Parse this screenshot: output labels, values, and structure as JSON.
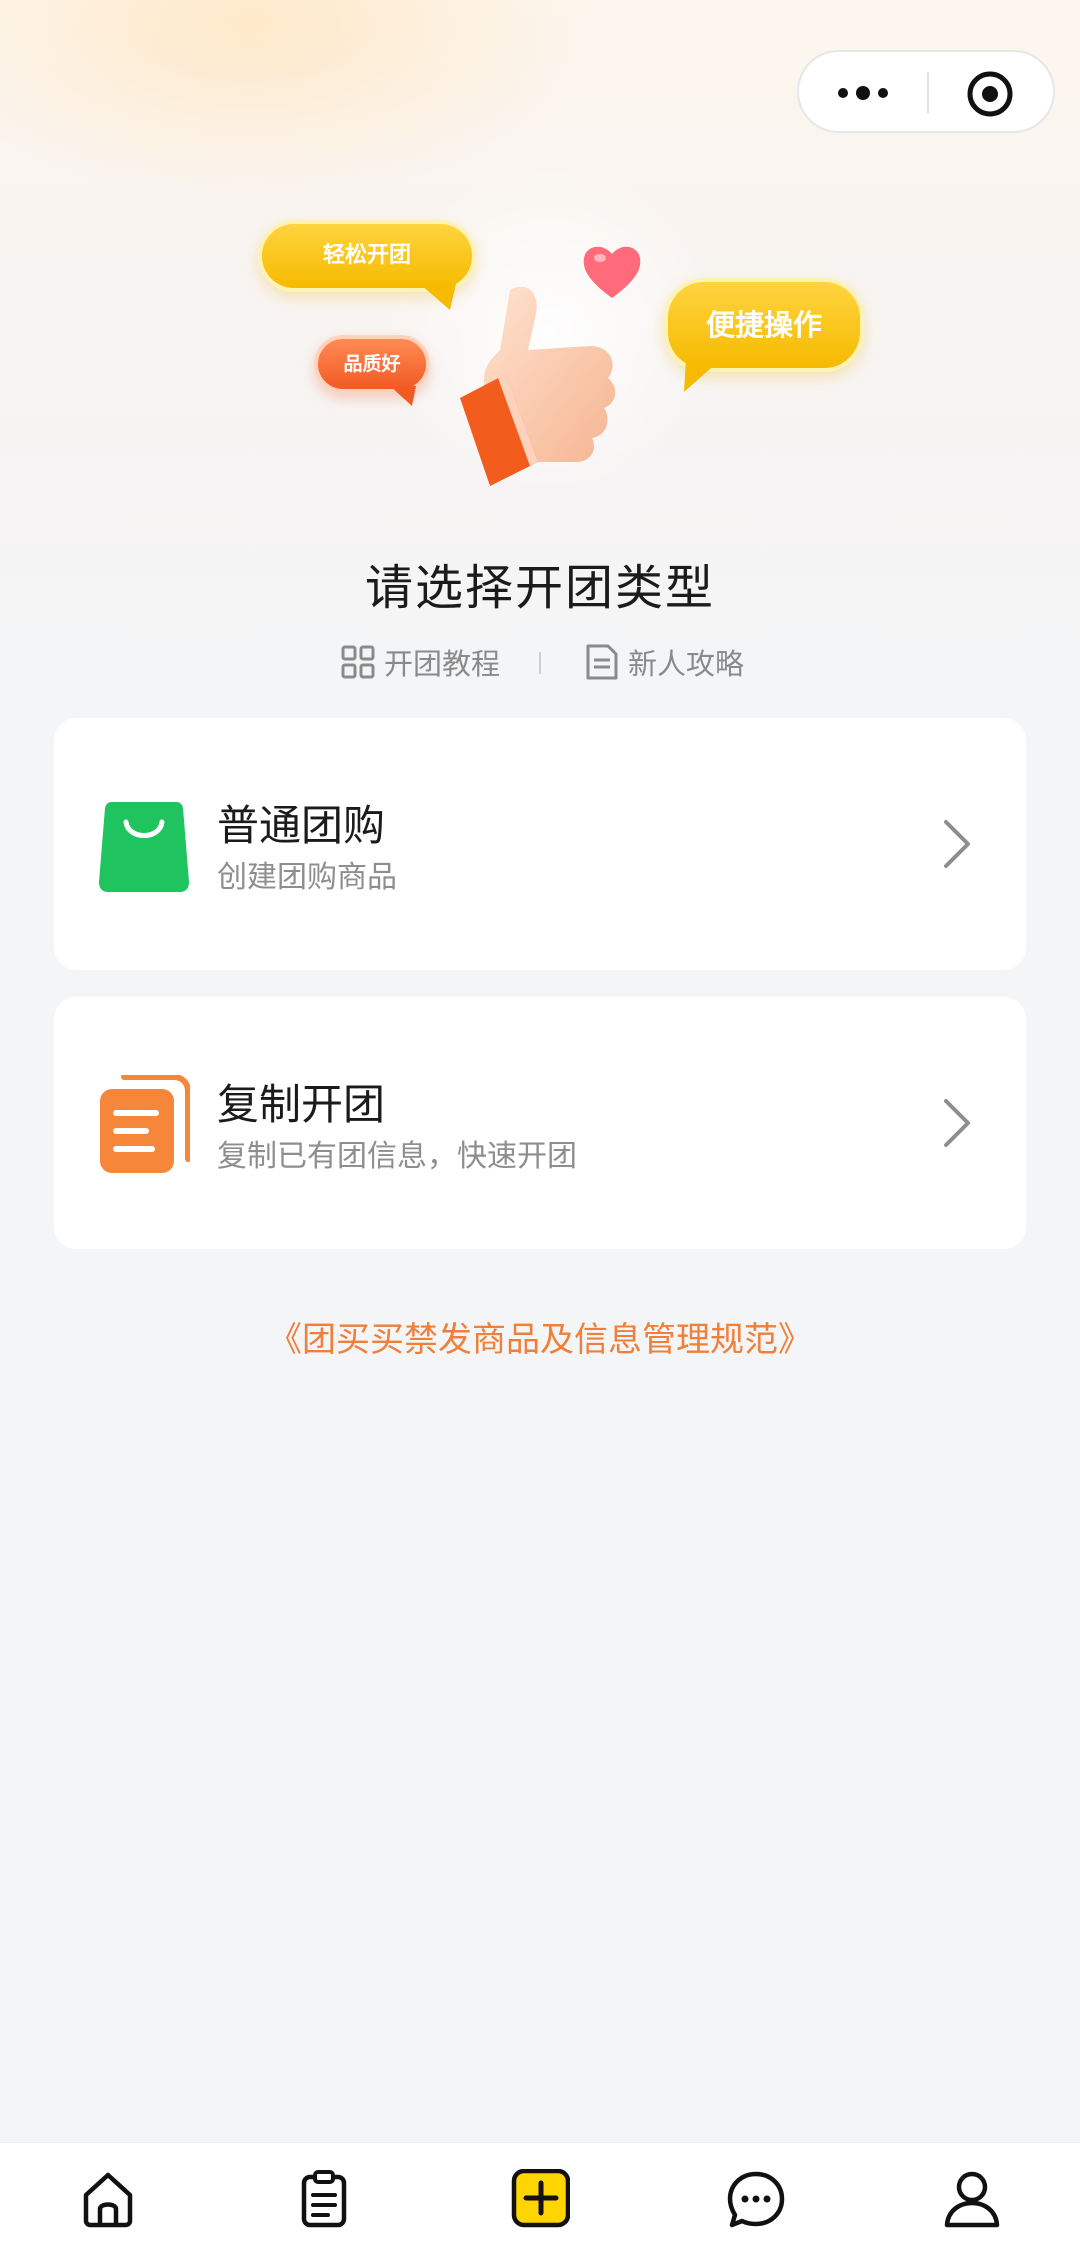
{
  "hero": {
    "bubbles": [
      "轻松开团",
      "品质好",
      "便捷操作"
    ]
  },
  "page_title": "请选择开团类型",
  "links": [
    {
      "label": "开团教程",
      "icon": "grid-icon"
    },
    {
      "label": "新人攻略",
      "icon": "document-icon"
    }
  ],
  "options": [
    {
      "title": "普通团购",
      "subtitle": "创建团购商品",
      "icon": "shopping-bag-icon",
      "color": "#1fc45e"
    },
    {
      "title": "复制开团",
      "subtitle": "复制已有团信息，快速开团",
      "icon": "copy-document-icon",
      "color": "#f5863a"
    }
  ],
  "agreement": "《团买买禁发商品及信息管理规范》",
  "tabbar": {
    "items": [
      {
        "icon": "home-icon"
      },
      {
        "icon": "clipboard-icon"
      },
      {
        "icon": "add-icon",
        "accent": "#ffd500"
      },
      {
        "icon": "chat-icon"
      },
      {
        "icon": "user-icon"
      }
    ]
  },
  "colors": {
    "accent_orange": "#f07f3a",
    "accent_yellow": "#ffd500",
    "background": "#f4f5f7"
  }
}
